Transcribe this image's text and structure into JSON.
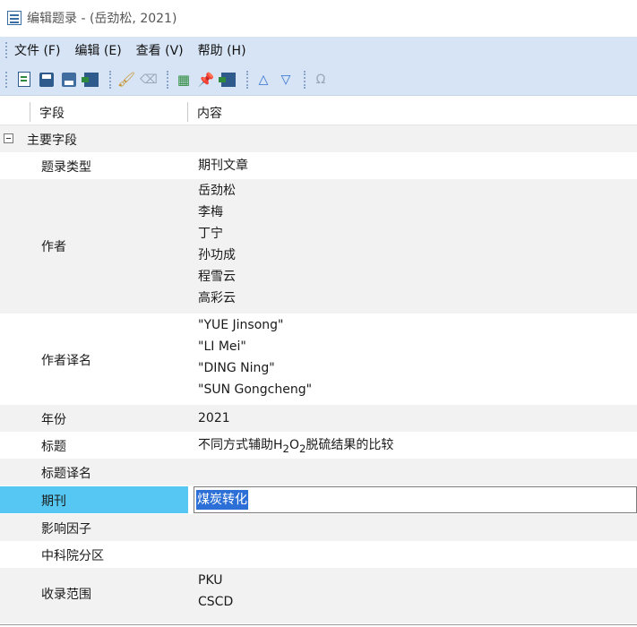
{
  "window": {
    "title": "编辑题录 - (岳劲松, 2021)"
  },
  "menu": [
    "文件 (F)",
    "编辑 (E)",
    "查看 (V)",
    "帮助 (H)"
  ],
  "toolbar": {
    "buttons": [
      "new-icon",
      "save-icon",
      "save-as-icon",
      "exit-icon",
      "clear-icon",
      "clean-disabled-icon",
      "fields-icon",
      "pin-icon",
      "close-icon",
      "move-up-icon",
      "move-down-icon",
      "omega-icon"
    ],
    "omega": "Ω"
  },
  "grid": {
    "col_field": "字段",
    "col_value": "内容",
    "group": "主要字段",
    "rows": {
      "type": {
        "field": "题录类型",
        "value": "期刊文章"
      },
      "authors": {
        "field": "作者",
        "values": [
          "岳劲松",
          "李梅",
          "丁宁",
          "孙功成",
          "程雪云",
          "高彩云"
        ]
      },
      "authors_en": {
        "field": "作者译名",
        "values": [
          "\"YUE Jinsong\"",
          "\"LI Mei\"",
          "\"DING Ning\"",
          "\"SUN Gongcheng\""
        ]
      },
      "year": {
        "field": "年份",
        "value": "2021"
      },
      "title": {
        "field": "标题",
        "value_pre": "不同方式辅助H",
        "sub1": "2",
        "value_mid": "O",
        "sub2": "2",
        "value_post": "脱硫结果的比较"
      },
      "title_en": {
        "field": "标题译名",
        "value": ""
      },
      "journal": {
        "field": "期刊",
        "value": "煤炭转化"
      },
      "impact": {
        "field": "影响因子",
        "value": ""
      },
      "cas": {
        "field": "中科院分区",
        "value": ""
      },
      "indexed": {
        "field": "收录范围",
        "values": [
          "PKU",
          "CSCD"
        ]
      }
    }
  },
  "colors": {
    "selection_left": "#55c7f2",
    "selection_text": "#2c6fd6",
    "toolbar_bg": "#d6e4f5"
  }
}
